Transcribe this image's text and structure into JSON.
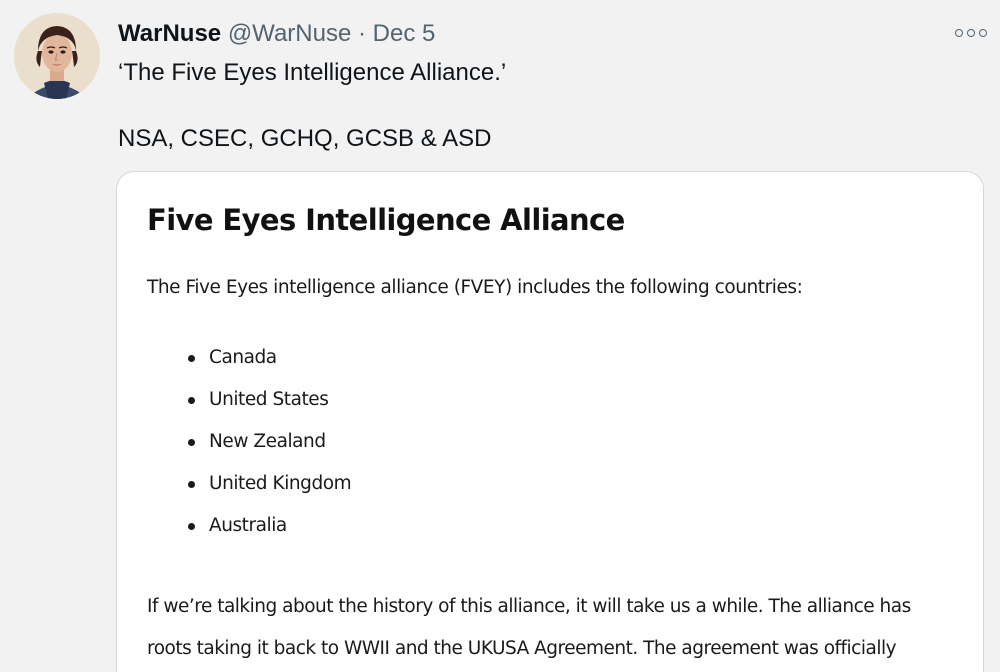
{
  "tweet": {
    "author_name": "WarNuse",
    "handle": "@WarNuse",
    "separator": "·",
    "date": "Dec 5",
    "text_line1": "‘The Five Eyes Intelligence Alliance.’",
    "text_line2": "NSA, CSEC, GCHQ, GCSB & ASD",
    "more_icon": "more-options-icon"
  },
  "card": {
    "title": "Five Eyes Intelligence Alliance",
    "intro": "The Five Eyes intelligence alliance (FVEY) includes the following countries:",
    "countries": [
      "Canada",
      "United States",
      "New Zealand",
      "United Kingdom",
      "Australia"
    ],
    "body": "If we’re talking about the history of this alliance, it will take us a while. The alliance has roots taking it back to WWII and the UKUSA Agreement. The agreement was officially"
  }
}
